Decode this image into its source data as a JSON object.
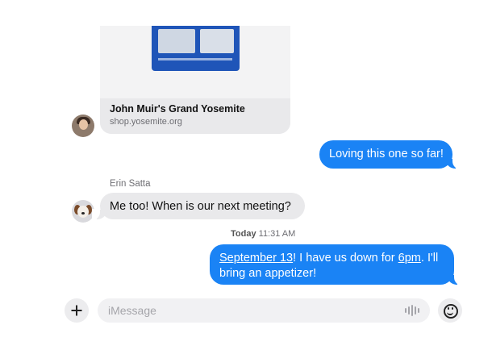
{
  "link_preview": {
    "title": "John Muir's Grand Yosemite",
    "url": "shop.yosemite.org"
  },
  "messages": [
    {
      "id": "m1",
      "side": "outgoing",
      "text": "Loving this one so far!"
    },
    {
      "id": "m2",
      "side": "incoming",
      "sender": "Erin Satta",
      "text": "Me too! When is our next meeting?"
    },
    {
      "id": "m3",
      "side": "outgoing",
      "parts": {
        "date_link": "September 13",
        "text1": "! I have us down for ",
        "time_link": "6pm",
        "text2": ". I'll bring an appetizer!"
      }
    }
  ],
  "timestamp": {
    "day": "Today",
    "time": "11:31 AM"
  },
  "composer": {
    "placeholder": "iMessage"
  },
  "colors": {
    "outgoing_bubble": "#1a83f5",
    "incoming_bubble": "#e9e9eb",
    "background": "#ffffff"
  },
  "icons": {
    "add": "plus-icon",
    "audio": "waveform-icon",
    "emoji": "smiley-icon"
  }
}
